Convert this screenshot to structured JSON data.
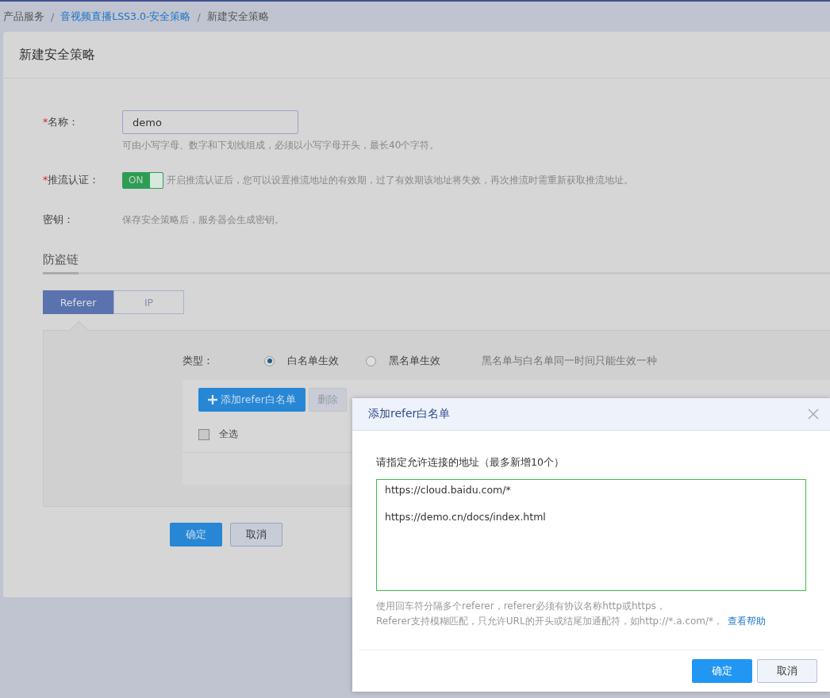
{
  "breadcrumb": {
    "items": [
      {
        "label": "产品服务",
        "link": false
      },
      {
        "label": "音视频直播LSS3.0-安全策略",
        "link": true
      },
      {
        "label": "新建安全策略",
        "link": false
      }
    ],
    "separators": [
      "/",
      "/"
    ]
  },
  "card": {
    "title": "新建安全策略"
  },
  "fields": [
    {
      "kind": "input",
      "required_mark": "*",
      "label": "名称：",
      "value": "demo",
      "hint": "可由小写字母、数字和下划线组成，必须以小写字母开头，最长40个字符。"
    },
    {
      "kind": "toggle",
      "required_mark": "*",
      "label": "推流认证：",
      "on": true,
      "toggle_label": "ON",
      "description": "开启推流认证后，您可以设置推流地址的有效期，过了有效期该地址将失效，再次推流时需重新获取推流地址。"
    },
    {
      "kind": "text",
      "label": "密钥：",
      "description": "保存安全策略后，服务器会生成密钥。"
    }
  ],
  "section": {
    "title": "防盗链",
    "tabs": [
      {
        "label": "Referer",
        "selected": true
      },
      {
        "label": "IP",
        "selected": false
      }
    ]
  },
  "type_row": {
    "label": "类型：",
    "options": [
      {
        "label": "白名单生效",
        "selected": true
      },
      {
        "label": "黑名单生效",
        "selected": false
      }
    ],
    "note": "黑名单与白名单同一时间只能生效一种"
  },
  "toolbar": {
    "add_button": "添加refer白名单",
    "delete_button": {
      "label": "删除",
      "disabled": true
    }
  },
  "select_all": {
    "label": "全选",
    "checked": false
  },
  "footer_buttons": [
    {
      "label": "确定",
      "kind": "primary"
    },
    {
      "label": "取消",
      "kind": "secondary"
    }
  ],
  "dialog": {
    "title": "添加refer白名单",
    "prompt": "请指定允许连接的地址（最多新增10个）",
    "value": "https://cloud.baidu.com/*\n\nhttps://demo.cn/docs/index.html",
    "help_lines": [
      "使用回车符分隔多个referer，referer必须有协议名称http或https，",
      "Referer支持模糊匹配，只允许URL的开头或结尾加通配符，如http://*.a.com/*，"
    ],
    "help_link": "查看帮助",
    "buttons": [
      {
        "label": "确定",
        "kind": "primary"
      },
      {
        "label": "取消",
        "kind": "secondary"
      }
    ]
  }
}
